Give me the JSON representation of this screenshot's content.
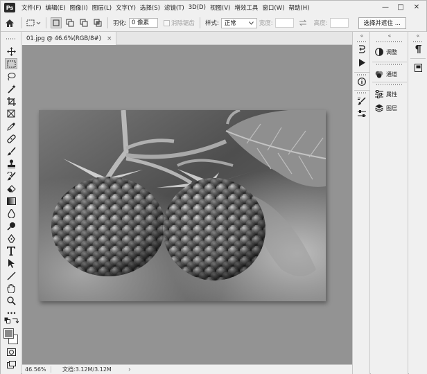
{
  "app": {
    "logo": "Ps",
    "menu": [
      "文件(F)",
      "编辑(E)",
      "图像(I)",
      "图层(L)",
      "文字(Y)",
      "选择(S)",
      "滤镜(T)",
      "3D(D)",
      "视图(V)",
      "增效工具",
      "窗口(W)",
      "帮助(H)"
    ],
    "window_controls": [
      "—",
      "□",
      "✕"
    ]
  },
  "options_bar": {
    "feather_label": "羽化:",
    "feather_value": "0 像素",
    "antialias_label": "消除锯齿",
    "style_label": "样式:",
    "style_value": "正常",
    "width_label": "宽度:",
    "height_label": "高度:",
    "select_mask_button": "选择并遮住 ..."
  },
  "document": {
    "tab_title": "01.jpg @ 46.6%(RGB/8#)",
    "tab_close": "×",
    "zoom": "46.56%",
    "doc_info": "文档:3.12M/3.12M",
    "status_arrow": "›"
  },
  "panels": {
    "collapse": "«",
    "items": [
      {
        "label": "调整",
        "icon": "adjustments-icon"
      },
      {
        "label": "通道",
        "icon": "channels-icon"
      },
      {
        "label": "属性",
        "icon": "properties-icon"
      },
      {
        "label": "图层",
        "icon": "layers-icon"
      }
    ],
    "mini": [
      "paragraph-icon",
      "glyphs-icon"
    ]
  },
  "colors": {
    "canvas_bg": "#939393",
    "ui_bg": "#f0f0f0",
    "foreground": "#8a8a8a",
    "background": "#ffffff"
  }
}
